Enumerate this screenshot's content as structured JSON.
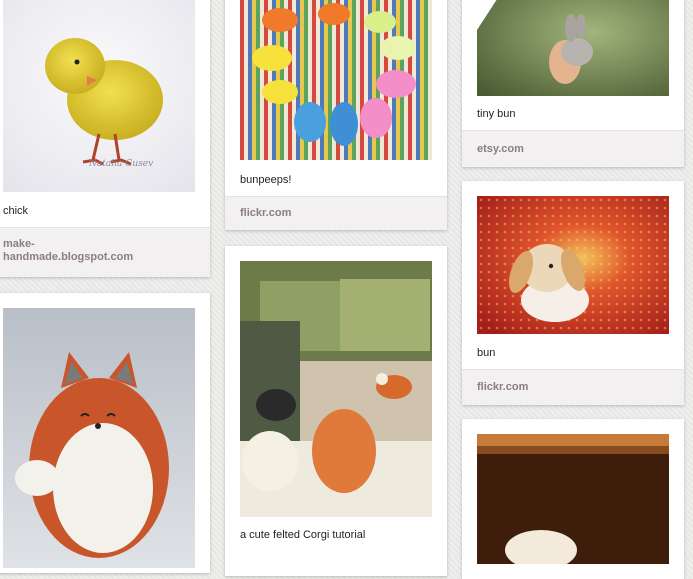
{
  "pins": [
    {
      "id": "chick",
      "description": "chick",
      "source": "make-handmade.blogspot.com",
      "image_icon": "chick-photo",
      "watermark": "Natalia Gusev"
    },
    {
      "id": "fox",
      "description": "",
      "source": "",
      "image_icon": "fox-photo"
    },
    {
      "id": "bunpeeps",
      "description": "bunpeeps!",
      "source": "flickr.com",
      "image_icon": "bunpeeps-photo"
    },
    {
      "id": "corgi",
      "description": "a cute felted Corgi tutorial",
      "source": "",
      "image_icon": "corgi-tutorial-photo"
    },
    {
      "id": "tinybun",
      "description": "tiny bun",
      "source": "etsy.com",
      "image_icon": "tiny-bun-photo"
    },
    {
      "id": "bun",
      "description": "bun",
      "source": "flickr.com",
      "image_icon": "bun-photo"
    },
    {
      "id": "wood",
      "description": "",
      "source": "",
      "image_icon": "bunny-in-wood-box-photo"
    }
  ],
  "colors": {
    "background": "#ecebea",
    "card": "#ffffff",
    "source_bar": "#f2f0f0",
    "source_text": "#8c7e7e"
  }
}
